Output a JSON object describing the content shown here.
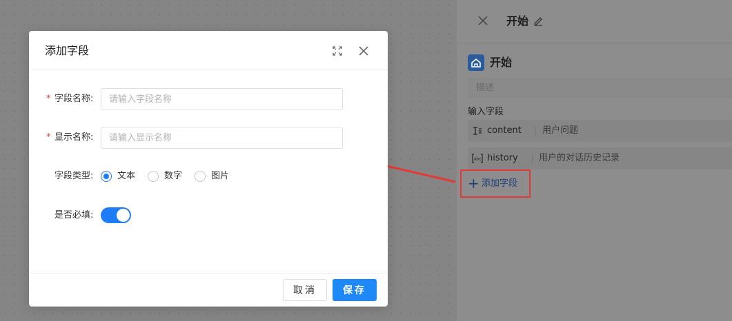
{
  "modal": {
    "title": "添加字段",
    "fields": {
      "field_name": {
        "label": "字段名称:",
        "placeholder": "请输入字段名称",
        "required": true
      },
      "display_name": {
        "label": "显示名称:",
        "placeholder": "请输入显示名称",
        "required": true
      },
      "field_type": {
        "label": "字段类型:",
        "options": [
          "文本",
          "数字",
          "图片"
        ],
        "selected": "文本"
      },
      "required_toggle": {
        "label": "是否必填:",
        "value": true
      }
    },
    "required_mark": "*",
    "cancel_label": "取消",
    "save_label": "保存"
  },
  "panel": {
    "title": "开始",
    "node_name": "开始",
    "description_placeholder": "描述",
    "inputs_label": "输入字段",
    "inputs": [
      {
        "name": "content",
        "description": "用户问题",
        "icon": "text-icon"
      },
      {
        "name": "history",
        "description": "用户的对话历史记录",
        "icon": "abc-icon"
      }
    ],
    "add_field_label": "添加字段"
  },
  "colors": {
    "primary": "#1e88f7",
    "required": "#e53935",
    "highlight": "#e53935",
    "node_icon": "#2b5b9c"
  }
}
